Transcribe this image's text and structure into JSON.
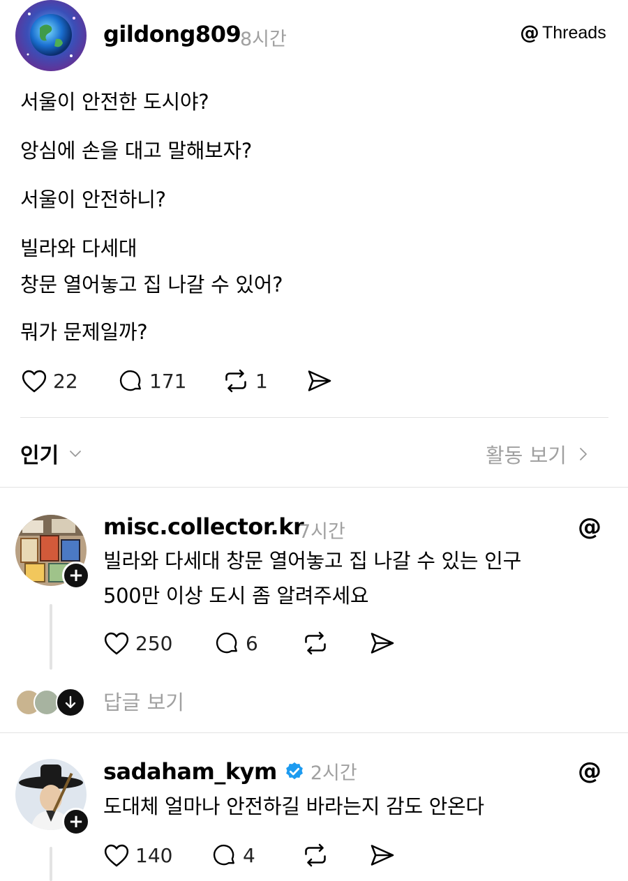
{
  "post": {
    "author": "gildong809",
    "time": "8시간",
    "brand": "Threads",
    "lines": [
      "서울이 안전한 도시야?",
      "앙심에 손을 대고 말해보자?",
      "서울이 안전하니?",
      "빌라와 다세대",
      "창문 열어놓고 집 나갈 수 있어?",
      "뭐가 문제일까?"
    ],
    "likes": "22",
    "comments": "171",
    "reposts": "1"
  },
  "sort": {
    "label": "인기",
    "activity": "활동 보기"
  },
  "replies": [
    {
      "author": "misc.collector.kr",
      "time": "7시간",
      "lines": [
        "빌라와 다세대 창문 열어놓고 집 나갈 수 있는 인구",
        "500만 이상 도시 좀 알려주세요"
      ],
      "likes": "250",
      "comments": "6",
      "view_replies": "답글 보기"
    },
    {
      "author": "sadaham_kym",
      "time": "2시간",
      "lines": [
        "도대체 얼마나 안전하길 바라는지 감도 안온다"
      ],
      "likes": "140",
      "comments": "4"
    }
  ],
  "colors": {
    "muted": "#a0a0a0",
    "divider": "#e2e2e2",
    "verified": "#1d9bf0"
  },
  "icons": [
    "heart-icon",
    "comment-icon",
    "repost-icon",
    "share-icon",
    "threads-logo-icon",
    "chevron-down-icon",
    "chevron-right-icon",
    "plus-icon",
    "verified-icon",
    "arrow-down-icon"
  ]
}
